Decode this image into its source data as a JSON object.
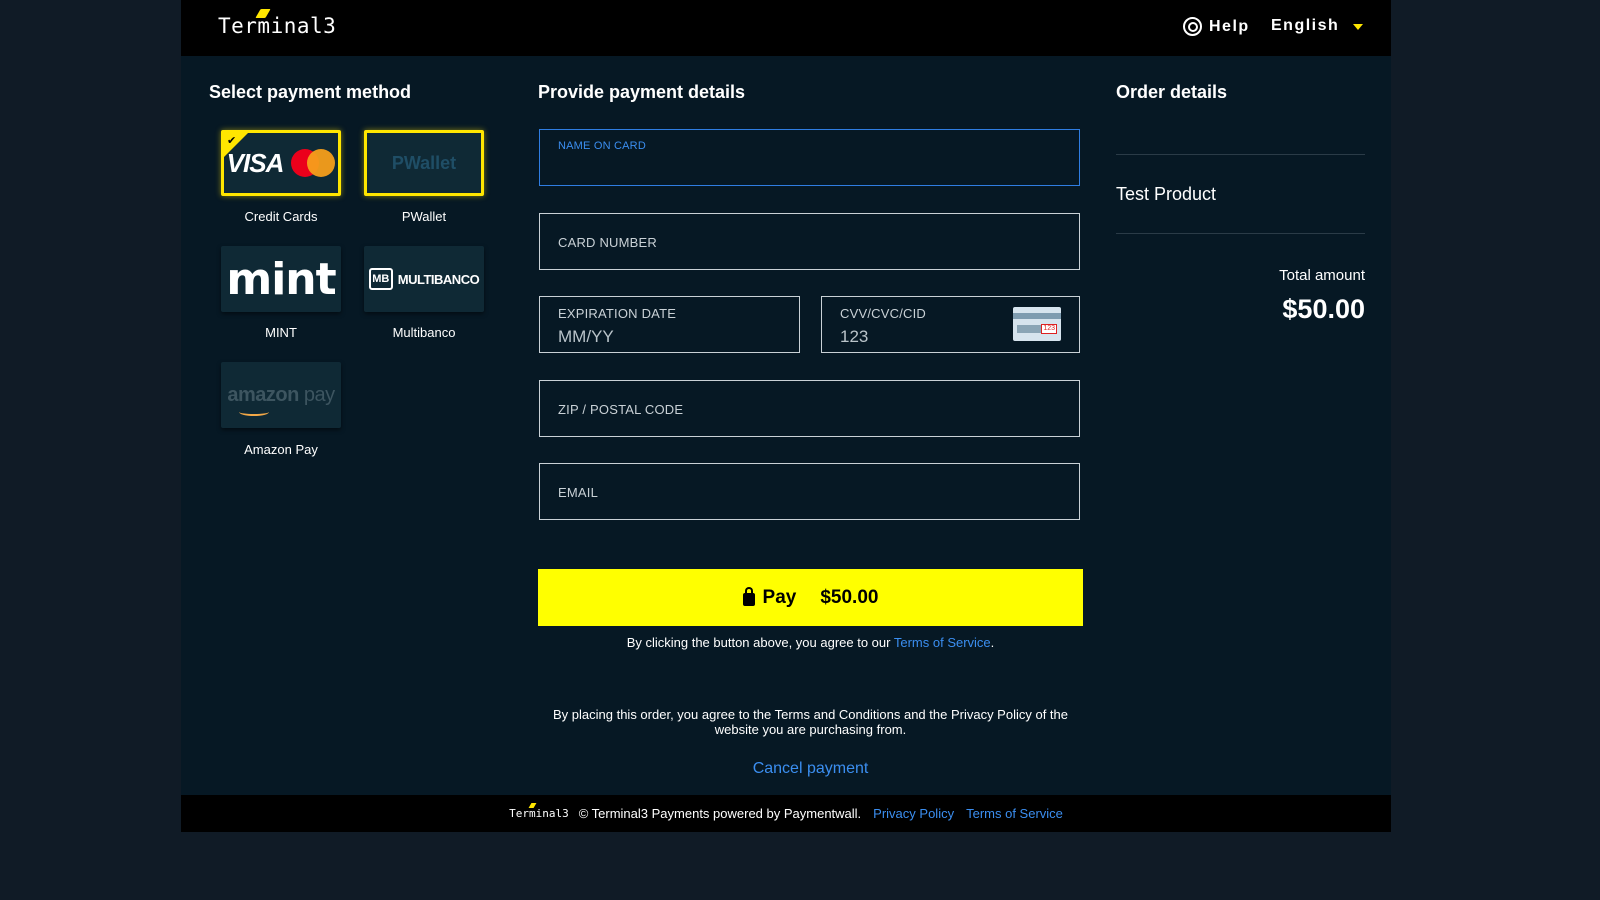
{
  "header": {
    "logo_text": "Terminal3",
    "help_label": "Help",
    "language": "English"
  },
  "payment_methods": {
    "title": "Select payment method",
    "items": [
      {
        "label": "Credit Cards",
        "logo": "VISA",
        "selected": true
      },
      {
        "label": "PWallet",
        "logo": "PWallet",
        "selected": false
      },
      {
        "label": "MINT",
        "logo": "mint",
        "selected": false
      },
      {
        "label": "Multibanco",
        "logo": "MULTIBANCO",
        "logo_badge": "MB",
        "selected": false
      },
      {
        "label": "Amazon Pay",
        "logo": "amazon",
        "logo_suffix": "pay",
        "selected": false
      }
    ]
  },
  "payment_details": {
    "title": "Provide payment details",
    "fields": {
      "name_on_card": {
        "label": "NAME ON CARD",
        "value": ""
      },
      "card_number": {
        "label": "CARD NUMBER",
        "value": ""
      },
      "expiration": {
        "label": "EXPIRATION DATE",
        "placeholder": "MM/YY"
      },
      "cvv": {
        "label": "CVV/CVC/CID",
        "placeholder": "123",
        "card_code": "123"
      },
      "zip": {
        "label": "ZIP / POSTAL CODE",
        "value": ""
      },
      "email": {
        "label": "EMAIL",
        "value": ""
      }
    },
    "pay_button": {
      "label": "Pay",
      "amount": "$50.00"
    },
    "agree_text": "By clicking the button above, you agree to our",
    "terms_link": "Terms of Service",
    "placing_text": "By placing this order, you agree to the Terms and Conditions and the Privacy Policy of the website you are purchasing from.",
    "cancel_label": "Cancel payment"
  },
  "order": {
    "title": "Order details",
    "product_name": "Test Product",
    "total_label": "Total amount",
    "total_amount": "$50.00"
  },
  "footer": {
    "logo_text": "Terminal3",
    "copyright": "© Terminal3 Payments powered by Paymentwall.",
    "privacy_link": "Privacy Policy",
    "terms_link": "Terms of Service"
  },
  "colors": {
    "accent_yellow": "#ffff00",
    "link_blue": "#3b8ef0",
    "background": "#061824"
  }
}
